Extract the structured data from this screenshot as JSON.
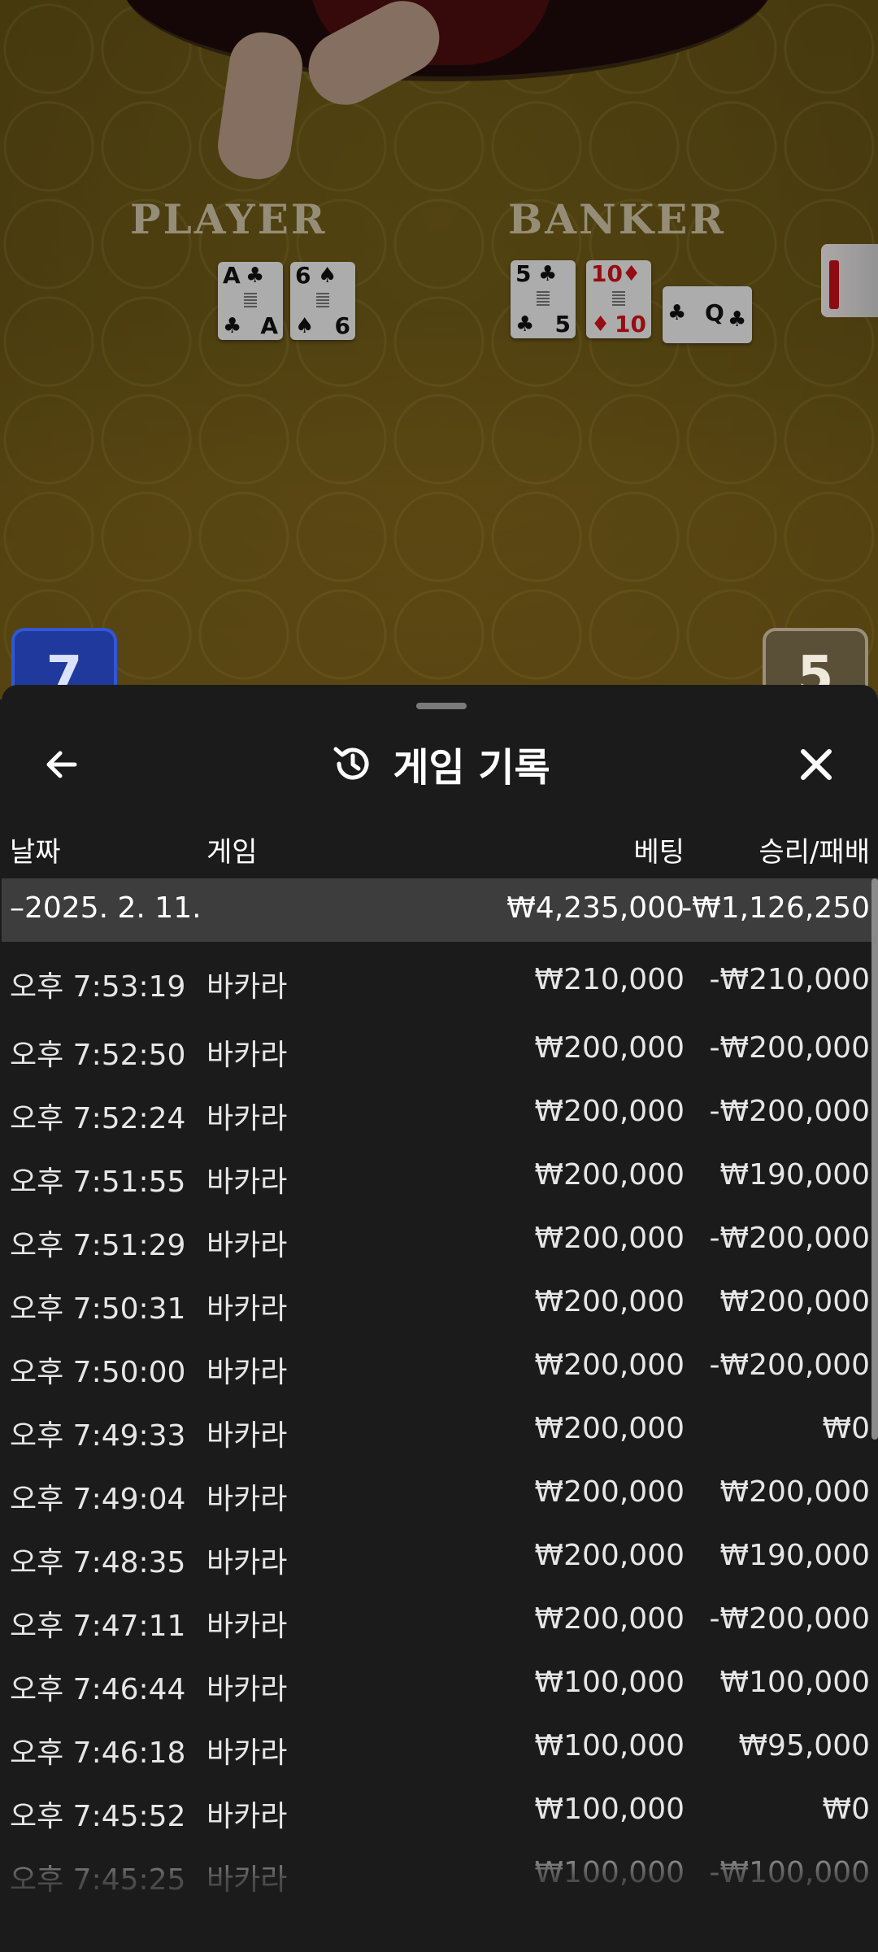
{
  "game_table": {
    "player_label": "PLAYER",
    "banker_label": "BANKER",
    "player_cards": [
      {
        "rank": "A",
        "suit": "♣"
      },
      {
        "rank": "6",
        "suit": "♠"
      }
    ],
    "banker_cards": [
      {
        "rank": "5",
        "suit": "♣"
      },
      {
        "rank": "10",
        "suit": "♦"
      },
      {
        "rank": "Q",
        "suit": "♣"
      }
    ],
    "player_score": "7",
    "banker_score": "5"
  },
  "sheet": {
    "title": "게임 기록",
    "icons": {
      "back": "arrow-left-icon",
      "history": "history-icon",
      "close": "close-icon"
    },
    "columns": {
      "date": "날짜",
      "game": "게임",
      "bet": "베팅",
      "result": "승리/패배"
    },
    "summary": {
      "date": "–2025. 2. 11.",
      "bet": "₩4,235,000",
      "result": "-₩1,126,250"
    },
    "rows": [
      {
        "time": "오후 7:53:19",
        "game": "바카라",
        "bet": "₩210,000",
        "result": "-₩210,000"
      },
      {
        "time": "오후 7:52:50",
        "game": "바카라",
        "bet": "₩200,000",
        "result": "-₩200,000"
      },
      {
        "time": "오후 7:52:24",
        "game": "바카라",
        "bet": "₩200,000",
        "result": "-₩200,000"
      },
      {
        "time": "오후 7:51:55",
        "game": "바카라",
        "bet": "₩200,000",
        "result": "₩190,000"
      },
      {
        "time": "오후 7:51:29",
        "game": "바카라",
        "bet": "₩200,000",
        "result": "-₩200,000"
      },
      {
        "time": "오후 7:50:31",
        "game": "바카라",
        "bet": "₩200,000",
        "result": "₩200,000"
      },
      {
        "time": "오후 7:50:00",
        "game": "바카라",
        "bet": "₩200,000",
        "result": "-₩200,000"
      },
      {
        "time": "오후 7:49:33",
        "game": "바카라",
        "bet": "₩200,000",
        "result": "₩0"
      },
      {
        "time": "오후 7:49:04",
        "game": "바카라",
        "bet": "₩200,000",
        "result": "₩200,000"
      },
      {
        "time": "오후 7:48:35",
        "game": "바카라",
        "bet": "₩200,000",
        "result": "₩190,000"
      },
      {
        "time": "오후 7:47:11",
        "game": "바카라",
        "bet": "₩200,000",
        "result": "-₩200,000"
      },
      {
        "time": "오후 7:46:44",
        "game": "바카라",
        "bet": "₩100,000",
        "result": "₩100,000"
      },
      {
        "time": "오후 7:46:18",
        "game": "바카라",
        "bet": "₩100,000",
        "result": "₩95,000"
      },
      {
        "time": "오후 7:45:52",
        "game": "바카라",
        "bet": "₩100,000",
        "result": "₩0"
      },
      {
        "time": "오후 7:45:25",
        "game": "바카라",
        "bet": "₩100,000",
        "result": "-₩100,000"
      }
    ]
  },
  "colors": {
    "sheet_bg": "#1b1b1b",
    "summary_bg": "#3d3d3d",
    "table_felt": "#7a6119",
    "player_badge": "#1f3a9c"
  }
}
